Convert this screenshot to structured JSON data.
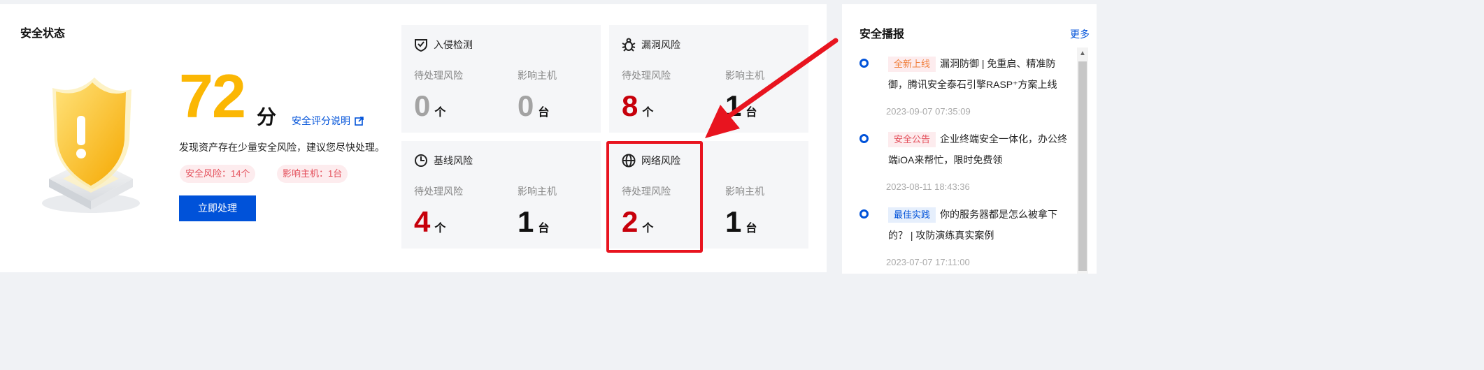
{
  "status": {
    "title": "安全状态",
    "score": "72",
    "score_unit": "分",
    "score_link": "安全评分说明",
    "description": "发现资产存在少量安全风险，建议您尽快处理。",
    "tag_risk": "安全风险：14个",
    "tag_hosts": "影响主机：1台",
    "action_button": "立即处理"
  },
  "cards": [
    {
      "title": "入侵检测",
      "icon": "shield-check-icon",
      "pending_label": "待处理风险",
      "pending_value": "0",
      "pending_unit": "个",
      "hosts_label": "影响主机",
      "hosts_value": "0",
      "hosts_unit": "台"
    },
    {
      "title": "漏洞风险",
      "icon": "bug-icon",
      "pending_label": "待处理风险",
      "pending_value": "8",
      "pending_unit": "个",
      "hosts_label": "影响主机",
      "hosts_value": "1",
      "hosts_unit": "台"
    },
    {
      "title": "基线风险",
      "icon": "clock-icon",
      "pending_label": "待处理风险",
      "pending_value": "4",
      "pending_unit": "个",
      "hosts_label": "影响主机",
      "hosts_value": "1",
      "hosts_unit": "台"
    },
    {
      "title": "网络风险",
      "icon": "globe-icon",
      "pending_label": "待处理风险",
      "pending_value": "2",
      "pending_unit": "个",
      "hosts_label": "影响主机",
      "hosts_value": "1",
      "hosts_unit": "台"
    }
  ],
  "news": {
    "title": "安全播报",
    "more": "更多",
    "items": [
      {
        "tag": "全新上线",
        "text": "漏洞防御 | 免重启、精准防御，腾讯安全泰石引擎RASP⁺方案上线",
        "time": "2023-09-07 07:35:09"
      },
      {
        "tag": "安全公告",
        "text": "企业终端安全一体化，办公终端iOA来帮忙，限时免费领",
        "time": "2023-08-11 18:43:36"
      },
      {
        "tag": "最佳实践",
        "text": "你的服务器都是怎么被拿下的？ | 攻防演练真实案例",
        "time": "2023-07-07 17:11:00"
      }
    ]
  },
  "colors": {
    "score": "#fbb704",
    "primary": "#0052d9",
    "risk_red": "#c7000b",
    "zero_gray": "#a3a3a3",
    "annotation": "#e8141f"
  }
}
